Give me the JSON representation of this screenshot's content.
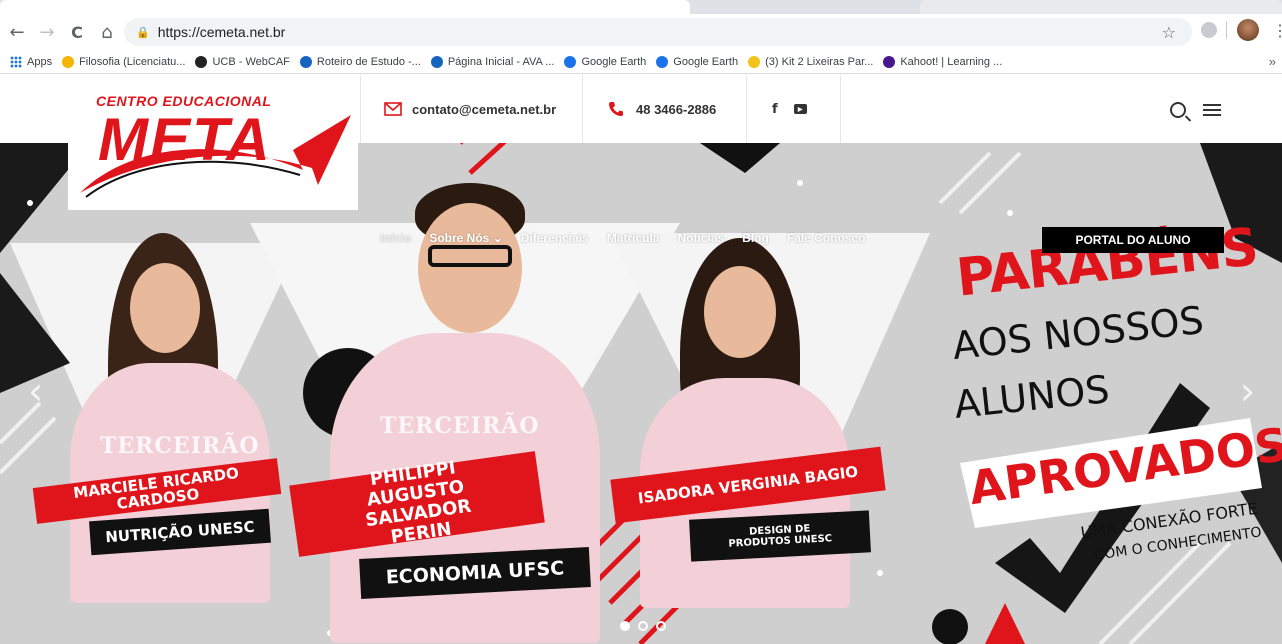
{
  "browser": {
    "url": "https://cemeta.net.br",
    "back_icon": "←",
    "forward_icon": "→",
    "reload_icon": "C",
    "home_icon": "⌂",
    "lock_icon": "🔒",
    "star_icon": "☆",
    "menu_icon": "⋮"
  },
  "bookmarks": [
    {
      "label": "Apps",
      "icon": "apps-grid",
      "color": "#1a73e8"
    },
    {
      "label": "Filosofia (Licenciatu...",
      "icon": "hand-icon",
      "color": "#f4b400"
    },
    {
      "label": "UCB - WebCAF",
      "icon": "ucb-logo",
      "color": "#222222"
    },
    {
      "label": "Roteiro de Estudo -...",
      "icon": "uv-logo",
      "color": "#1565c0"
    },
    {
      "label": "Página Inicial - AVA ...",
      "icon": "uv-logo",
      "color": "#1565c0"
    },
    {
      "label": "Google Earth",
      "icon": "earth-icon",
      "color": "#1a73e8"
    },
    {
      "label": "Google Earth",
      "icon": "earth-icon",
      "color": "#1a73e8"
    },
    {
      "label": "(3) Kit 2 Lixeiras Par...",
      "icon": "shop-icon",
      "color": "#f0c419"
    },
    {
      "label": "Kahoot! | Learning ...",
      "icon": "kahoot-icon",
      "color": "#46178f"
    }
  ],
  "bookmarks_more": "»",
  "header": {
    "logo_line1": "Centro Educacional",
    "logo_line2": "META",
    "email": "contato@cemeta.net.br",
    "phone": "48 3466-2886",
    "social_facebook": "f",
    "social_youtube": "▶"
  },
  "nav": {
    "items": [
      "Início",
      "Sobre Nós ⌄",
      "Diferenciais",
      "Matrícula",
      "Notícias",
      "Blog",
      "Fale Conosco"
    ],
    "portal_label": "PORTAL DO ALUNO"
  },
  "hero": {
    "students": [
      {
        "name": "MARCIELE RICARDO CARDOSO",
        "course": "NUTRIÇÃO UNESC"
      },
      {
        "name": "PHILIPPI AUGUSTO SALVADOR PERIN",
        "course": "ECONOMIA UFSC"
      },
      {
        "name": "ISADORA VERGINIA BAGIO",
        "course": "DESIGN DE PRODUTOS UNESC"
      }
    ],
    "shirt_text": "TERCEIRÃO",
    "headline_line1": "PARABÉNS",
    "headline_line2": "AOS NOSSOS",
    "headline_line3": "ALUNOS",
    "headline_line4": "APROVADOS",
    "tagline_line1": "UMA CONEXÃO FORTE",
    "tagline_line2": "COM O CONHECIMENTO",
    "prev_arrow": "‹",
    "next_arrow": "›",
    "slide_count": 3,
    "active_slide": 1
  },
  "colors": {
    "brand_red": "#e0151c",
    "black": "#111111",
    "hero_bg": "#c9c9c9"
  }
}
